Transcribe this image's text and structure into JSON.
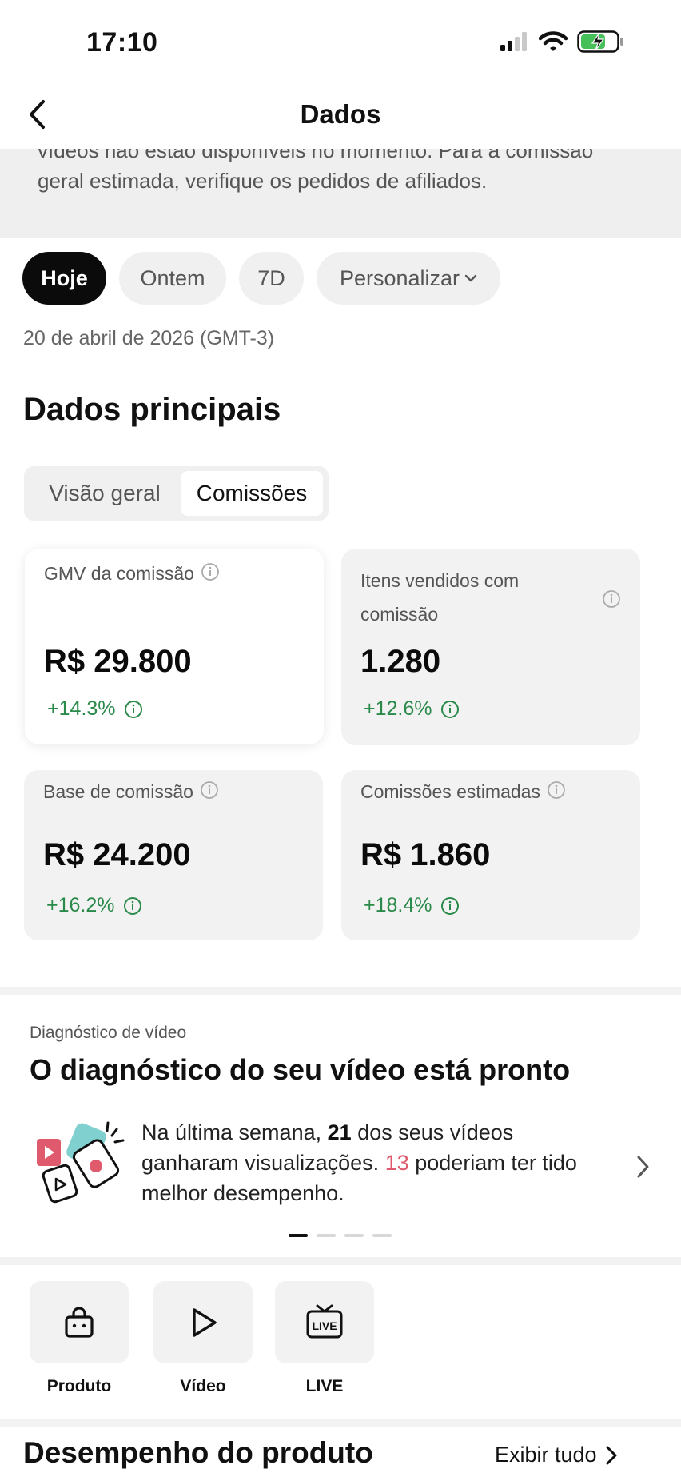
{
  "status_bar": {
    "time": "17:10"
  },
  "nav": {
    "title": "Dados"
  },
  "notice": {
    "text": "vídeos não estão disponíveis no momento. Para a comissão geral estimada, verifique os pedidos de afiliados."
  },
  "filters": {
    "chips": [
      "Hoje",
      "Ontem",
      "7D",
      "Personalizar"
    ],
    "active": "Hoje"
  },
  "date_label": "20 de abril de 2026 (GMT-3)",
  "main_data": {
    "title": "Dados principais",
    "tabs": [
      "Visão geral",
      "Comissões"
    ],
    "active_tab": "Comissões",
    "cards": [
      {
        "label": "GMV da comissão",
        "value": "R$ 29.800",
        "change": "+14.3%"
      },
      {
        "label": "Itens vendidos com comissão",
        "value": "1.280",
        "change": "+12.6%"
      },
      {
        "label": "Base de comissão",
        "value": "R$ 24.200",
        "change": "+16.2%"
      },
      {
        "label": "Comissões estimadas",
        "value": "R$ 1.860",
        "change": "+18.4%"
      }
    ]
  },
  "diagnosis": {
    "kicker": "Diagnóstico de vídeo",
    "title": "O diagnóstico do seu vídeo está pronto",
    "text_part1": "Na última semana,",
    "count_videos": "21",
    "text_part2": "dos seus vídeos ganharam visualizações.",
    "count_better": "13",
    "text_part3": "poderiam ter tido melhor desempenho.",
    "pager_total": 4,
    "pager_active": 1
  },
  "quick_links": [
    {
      "label": "Produto",
      "icon": "shopping-bag-icon"
    },
    {
      "label": "Vídeo",
      "icon": "play-icon"
    },
    {
      "label": "LIVE",
      "icon": "live-tv-icon"
    }
  ],
  "product_performance": {
    "title": "Desempenho do produto",
    "link_label": "Exibir tudo"
  },
  "colors": {
    "positive": "#2a8a4a",
    "highlight_red": "#e05a6e",
    "chip_active": "#0b0b0b",
    "card_bg": "#f2f2f2"
  }
}
